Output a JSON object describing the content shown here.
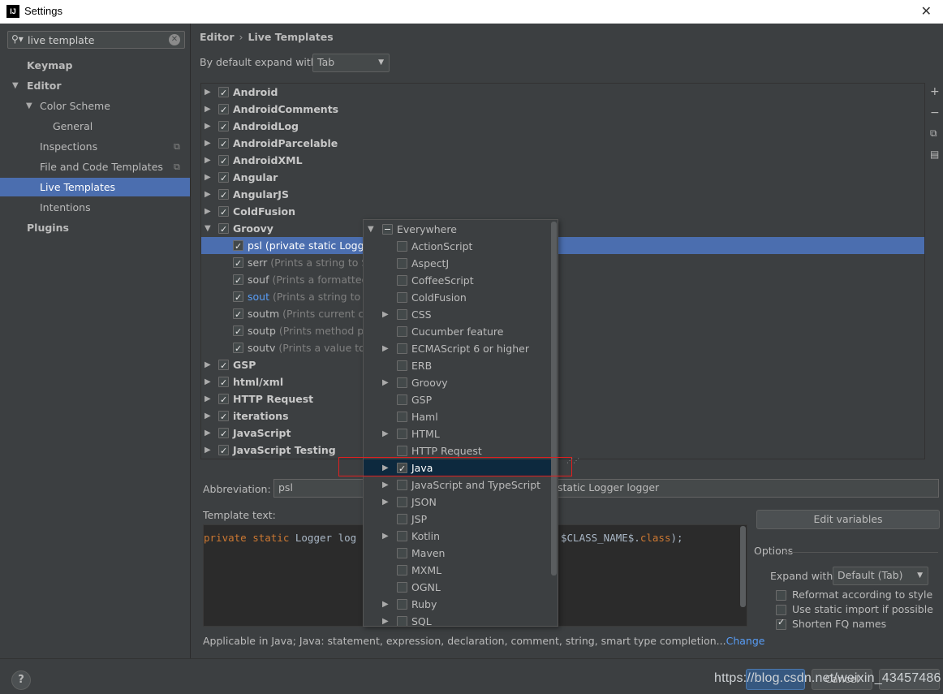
{
  "window": {
    "title": "Settings",
    "app_icon_text": "IJ",
    "close_label": "✕"
  },
  "sidebar": {
    "search_value": "live template",
    "items": [
      {
        "label": "Keymap"
      },
      {
        "label": "Editor"
      },
      {
        "label": "Color Scheme"
      },
      {
        "label": "General"
      },
      {
        "label": "Inspections"
      },
      {
        "label": "File and Code Templates"
      },
      {
        "label": "Live Templates"
      },
      {
        "label": "Intentions"
      },
      {
        "label": "Plugins"
      }
    ]
  },
  "breadcrumb": {
    "parent": "Editor",
    "separator": "›",
    "current": "Live Templates"
  },
  "expand_default": {
    "label": "By default expand with",
    "value": "Tab"
  },
  "tree": {
    "groups_top": [
      {
        "name": "Android"
      },
      {
        "name": "AndroidComments"
      },
      {
        "name": "AndroidLog"
      },
      {
        "name": "AndroidParcelable"
      },
      {
        "name": "AndroidXML"
      },
      {
        "name": "Angular"
      },
      {
        "name": "AngularJS"
      },
      {
        "name": "ColdFusion"
      },
      {
        "name": "Groovy"
      }
    ],
    "groovy_children": [
      {
        "abbr": "psl",
        "desc": "(private static Logger"
      },
      {
        "abbr": "serr",
        "desc": "(Prints a string to Sy"
      },
      {
        "abbr": "souf",
        "desc": "(Prints a formatted"
      },
      {
        "abbr": "sout",
        "desc": "(Prints a string to Sy"
      },
      {
        "abbr": "soutm",
        "desc": "(Prints current clas"
      },
      {
        "abbr": "soutp",
        "desc": "(Prints method par"
      },
      {
        "abbr": "soutv",
        "desc": "(Prints a value to S"
      }
    ],
    "groups_bottom": [
      {
        "name": "GSP"
      },
      {
        "name": "html/xml"
      },
      {
        "name": "HTTP Request"
      },
      {
        "name": "iterations"
      },
      {
        "name": "JavaScript"
      },
      {
        "name": "JavaScript Testing"
      }
    ]
  },
  "toolbar": {
    "add": "+",
    "remove": "−",
    "copy": "⧉",
    "group": "▤"
  },
  "abbreviation": {
    "label": "Abbreviation:",
    "value": "psl",
    "description_value": "static Logger logger"
  },
  "template_text": {
    "label": "Template text:",
    "code_kw": "private static",
    "code_mid": " Logger log",
    "code_right_a": "$CLASS_NAME$.",
    "code_right_b": "class",
    "code_right_c": ");"
  },
  "applicable": {
    "text": "Applicable in Java; Java: statement, expression, declaration, comment, string, smart type completion...",
    "link": "Change"
  },
  "edit_variables": "Edit variables",
  "options": {
    "title": "Options",
    "expand_with_label": "Expand with",
    "expand_with_value": "Default (Tab)",
    "checkboxes": [
      {
        "label": "Reformat according to style",
        "checked": false
      },
      {
        "label": "Use static import if possible",
        "checked": false
      },
      {
        "label": "Shorten FQ names",
        "checked": true
      }
    ]
  },
  "context_popup": {
    "items": [
      {
        "label": "Everywhere"
      },
      {
        "label": "ActionScript"
      },
      {
        "label": "AspectJ"
      },
      {
        "label": "CoffeeScript"
      },
      {
        "label": "ColdFusion"
      },
      {
        "label": "CSS"
      },
      {
        "label": "Cucumber feature"
      },
      {
        "label": "ECMAScript 6 or higher"
      },
      {
        "label": "ERB"
      },
      {
        "label": "Groovy"
      },
      {
        "label": "GSP"
      },
      {
        "label": "Haml"
      },
      {
        "label": "HTML"
      },
      {
        "label": "HTTP Request"
      },
      {
        "label": "Java"
      },
      {
        "label": "JavaScript and TypeScript"
      },
      {
        "label": "JSON"
      },
      {
        "label": "JSP"
      },
      {
        "label": "Kotlin"
      },
      {
        "label": "Maven"
      },
      {
        "label": "MXML"
      },
      {
        "label": "OGNL"
      },
      {
        "label": "Ruby"
      },
      {
        "label": "SQL"
      }
    ]
  },
  "bottom": {
    "help": "?",
    "cancel_label": "Cancel",
    "watermark": "https://blog.csdn.net/weixin_43457486"
  },
  "colors": {
    "selection": "#4b6eaf",
    "panel": "#3c3f41",
    "editor_bg": "#2b2b2b",
    "keyword": "#cc7832",
    "link": "#589df6",
    "highlight_box": "#e02020"
  }
}
